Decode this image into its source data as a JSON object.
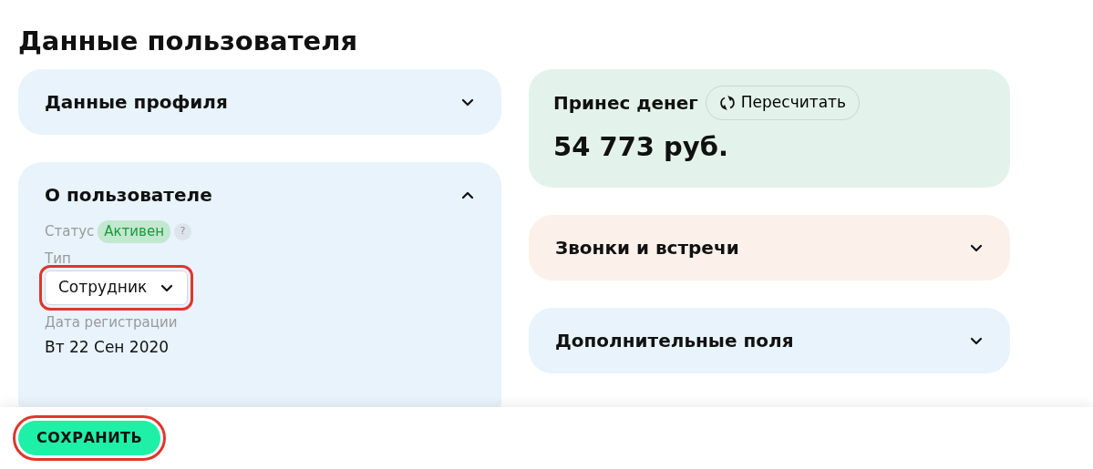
{
  "page_title": "Данные пользователя",
  "left_sections": [
    {
      "title": "Данные профиля",
      "expanded": false
    },
    {
      "title": "О пользователе",
      "expanded": true,
      "status": {
        "label": "Статус",
        "badge": "Активен",
        "help": "?"
      },
      "type": {
        "label": "Тип",
        "value": "Сотрудник",
        "highlighted": true
      },
      "registration": {
        "label": "Дата регистрации",
        "value": "Вт 22 Сен 2020"
      }
    }
  ],
  "revenue": {
    "title": "Принес денег",
    "button": "Пересчитать",
    "amount": "54 773 руб.",
    "color": "#e3f3ec"
  },
  "right_sections": [
    {
      "title": "Звонки и встречи",
      "expanded": false,
      "color": "#fcf0eb"
    },
    {
      "title": "Дополнительные поля",
      "expanded": false,
      "color": "#e8f3fb"
    }
  ],
  "save_button": {
    "label": "СОХРАНИТЬ",
    "highlighted": true
  }
}
